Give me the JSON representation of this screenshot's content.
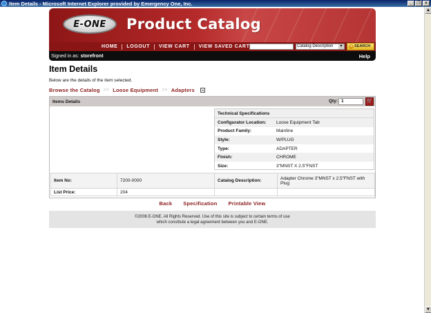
{
  "window": {
    "title": "Item Details - Microsoft Internet Explorer provided by Emergency One, Inc."
  },
  "header": {
    "logo_text": "E-ONE",
    "banner_title": "Product Catalog"
  },
  "nav": {
    "items": [
      "HOME",
      "LOGOUT",
      "VIEW CART",
      "VIEW SAVED CART"
    ],
    "search_value": "",
    "search_select": "Catalog Description",
    "search_button": "SEARCH"
  },
  "session": {
    "signed_in_label": "Signed in as:",
    "user": "storefront",
    "help": "Help"
  },
  "page": {
    "title": "Item Details",
    "description": "Below are the details of the item selected.",
    "breadcrumb": [
      "Browse the Catalog",
      "Loose Equipment",
      "Adapters"
    ],
    "breadcrumb_sep": ">>"
  },
  "panel": {
    "header": "Items Details",
    "qty_label": "Qty:",
    "qty_value": "1",
    "tech_title": "Technical Specifications",
    "specs": [
      {
        "k": "Configurator Location:",
        "v": "Loose Equipment Tab"
      },
      {
        "k": "Product Family:",
        "v": "Mainline"
      },
      {
        "k": "Style:",
        "v": "W/PLUG"
      },
      {
        "k": "Type:",
        "v": "ADAPTER"
      },
      {
        "k": "Finish:",
        "v": "CHROME"
      },
      {
        "k": "Size:",
        "v": "3\"MNST X 2.5\"FNST"
      }
    ],
    "item_no_label": "Item No:",
    "item_no": "7200-0000",
    "catalog_desc_label": "Catalog Description:",
    "catalog_desc": "Adapter Chrome 3\"MNST x 2.5\"FNST with Plug",
    "list_price_label": "List Price:",
    "list_price": "204"
  },
  "actions": {
    "back": "Back",
    "specification": "Specification",
    "printable": "Printable View"
  },
  "footer": {
    "line1": "©2006 E-ONE. All Rights Reserved. Use of this site is subject to certain terms of use",
    "line2": "which constitute a legal agreement between you and E-ONE."
  }
}
